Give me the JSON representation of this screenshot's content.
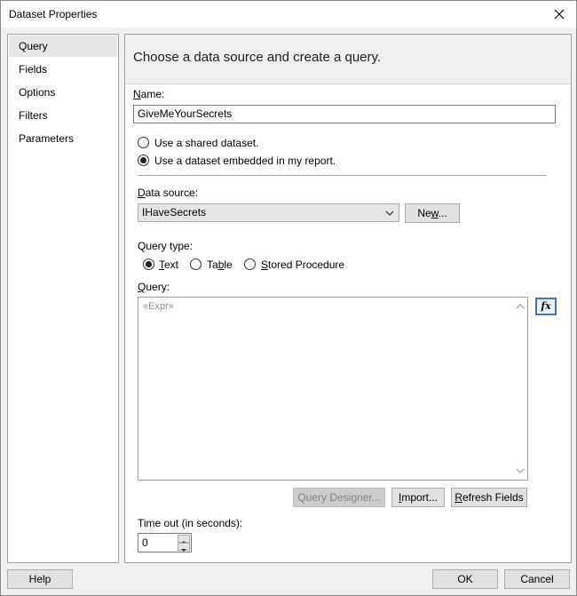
{
  "window": {
    "title": "Dataset Properties"
  },
  "sidebar": {
    "items": [
      {
        "label": "Query",
        "selected": true
      },
      {
        "label": "Fields"
      },
      {
        "label": "Options"
      },
      {
        "label": "Filters"
      },
      {
        "label": "Parameters"
      }
    ]
  },
  "header": {
    "text": "Choose a data source and create a query."
  },
  "name_field": {
    "label": "Name:",
    "value": "GiveMeYourSecrets"
  },
  "dataset_mode": {
    "shared_label": "Use a shared dataset.",
    "embedded_label": "Use a dataset embedded in my report.",
    "selected": "embedded"
  },
  "data_source": {
    "label": "Data source:",
    "value": "IHaveSecrets",
    "new_button": "New..."
  },
  "query_type": {
    "label": "Query type:",
    "options": [
      "Text",
      "Table",
      "Stored Procedure"
    ],
    "selected": "Text"
  },
  "query": {
    "label": "Query:",
    "placeholder": "«Expr»",
    "fx_label": "fx"
  },
  "query_buttons": {
    "designer": "Query Designer...",
    "import": "Import...",
    "refresh": "Refresh Fields"
  },
  "timeout": {
    "label": "Time out (in seconds):",
    "value": "0"
  },
  "footer": {
    "help": "Help",
    "ok": "OK",
    "cancel": "Cancel"
  },
  "icons": {
    "close": "close-icon",
    "combo_arrow": "chevron-down-icon",
    "scroll_up": "scroll-up-icon",
    "scroll_down": "scroll-down-icon",
    "spin_up": "spin-up-icon",
    "spin_down": "spin-down-icon"
  },
  "colors": {
    "fx_border": "#3b74c7",
    "selected_nav": "#e5e5e5"
  }
}
